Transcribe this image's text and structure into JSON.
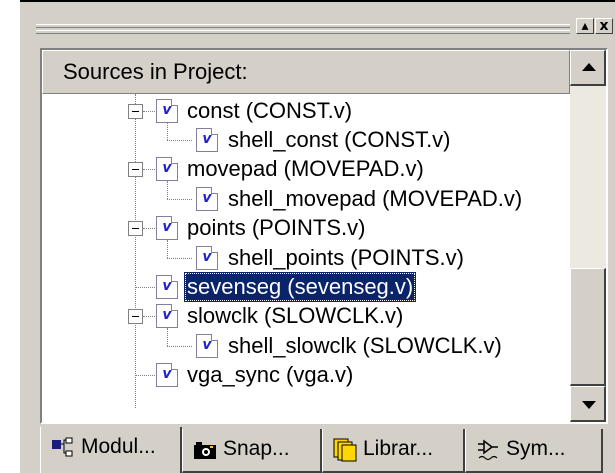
{
  "panel": {
    "title_buttons": {
      "restore": "▴",
      "close": "x"
    }
  },
  "sources": {
    "header": "Sources in Project:",
    "items": [
      {
        "label": "const (CONST.v)",
        "expander": "minus"
      },
      {
        "label": "shell_const (CONST.v)"
      },
      {
        "label": "movepad (MOVEPAD.v)",
        "expander": "minus"
      },
      {
        "label": "shell_movepad (MOVEPAD.v)"
      },
      {
        "label": "points (POINTS.v)",
        "expander": "minus"
      },
      {
        "label": "shell_points (POINTS.v)"
      },
      {
        "label": "sevenseg (sevenseg.v)",
        "selected": true
      },
      {
        "label": "slowclk (SLOWCLK.v)",
        "expander": "minus"
      },
      {
        "label": "shell_slowclk (SLOWCLK.v)"
      },
      {
        "label": "vga_sync (vga.v)"
      }
    ],
    "file_icon_letter": "v"
  },
  "tabs": [
    {
      "label": "Modul...",
      "icon": "module-hierarchy-icon",
      "active": true
    },
    {
      "label": "Snap...",
      "icon": "camera-icon"
    },
    {
      "label": "Librar...",
      "icon": "library-icon"
    },
    {
      "label": "Sym...",
      "icon": "symbol-icon"
    }
  ],
  "colors": {
    "selection": "#0a246a",
    "face": "#d4d0c8",
    "file_icon": "#2020d0"
  }
}
